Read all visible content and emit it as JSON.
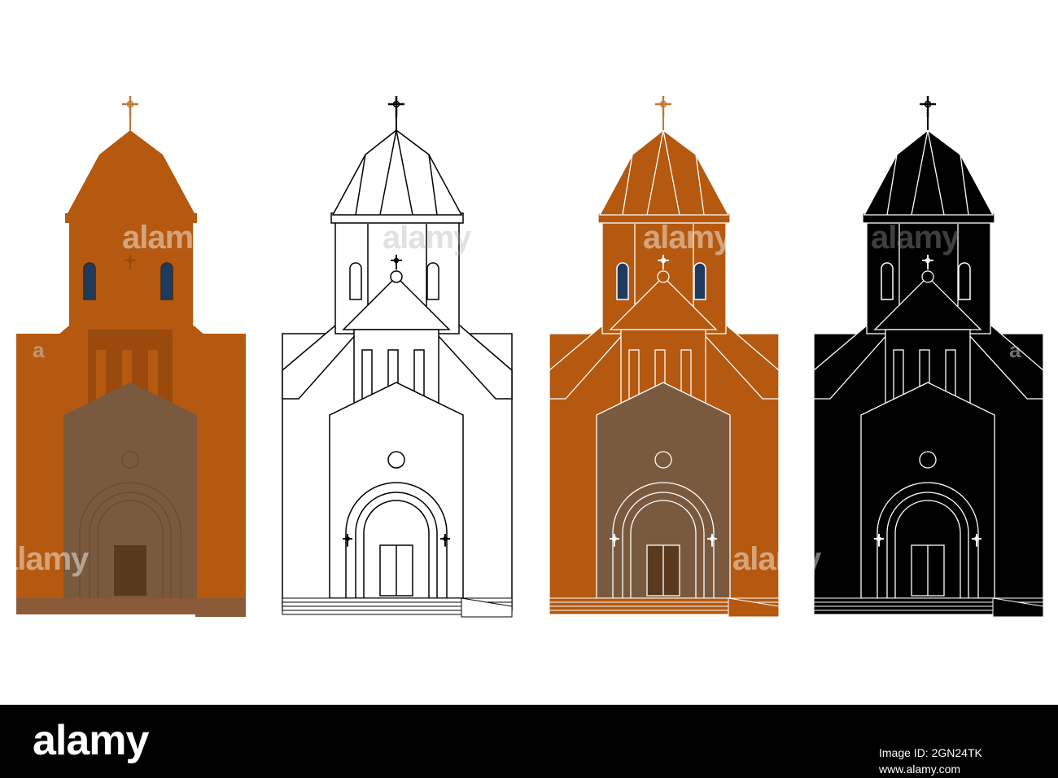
{
  "palette": {
    "orange": "#B4590F",
    "orange_dark": "#9A4A0C",
    "brown_portal": "#7A5A3E",
    "door": "#5A3A1E",
    "window_blue": "#1E3A5F",
    "cross_gold": "#C07838",
    "black": "#000000",
    "white": "#FFFFFF",
    "outline": "#000000"
  },
  "variants": [
    {
      "name": "flat-color",
      "fill": "#B4590F",
      "stroke": "none",
      "line": "none"
    },
    {
      "name": "outline",
      "fill": "#FFFFFF",
      "stroke": "#000000",
      "line": "#000000"
    },
    {
      "name": "color-with-white-lines",
      "fill": "#B4590F",
      "stroke": "#FFFFFF",
      "line": "#FFFFFF"
    },
    {
      "name": "black-silhouette",
      "fill": "#000000",
      "stroke": "#FFFFFF",
      "line": "#FFFFFF"
    }
  ],
  "watermark": {
    "text": "alamy",
    "side_text": "a"
  },
  "footer": {
    "logo": "alamy",
    "image_id": "Image ID: 2GN24TK",
    "url": "www.alamy.com"
  }
}
